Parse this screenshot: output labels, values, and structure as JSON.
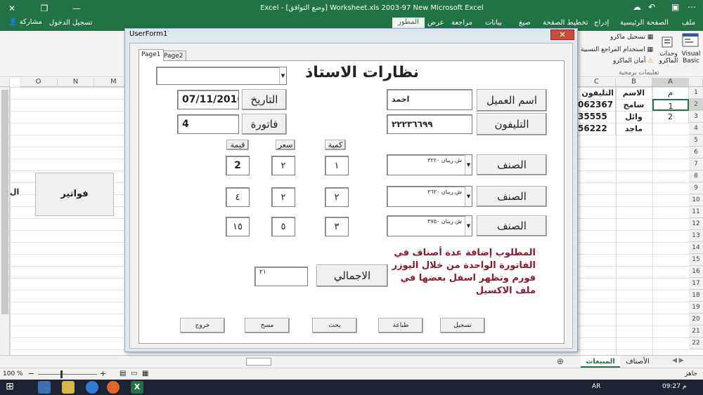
{
  "excel": {
    "title": "Excel - [وضع التوافق] Worksheet.xls 2003-97 New Microsoft Excel",
    "share": "مشاركة",
    "login": "تسجيل الدخول",
    "tabs": [
      "ملف",
      "الصفحة الرئيسية",
      "إدراج",
      "تخطيط الصفحة",
      "صيغ",
      "بيانات",
      "مراجعة",
      "عرض",
      "المطور"
    ],
    "active_tab": "المطور",
    "ribbon": {
      "visual_basic": "Visual Basic",
      "macros": "وحدات الماكرو",
      "record_macro": "تسجيل ماكرو",
      "relative_refs": "استخدام المراجع النسبية",
      "macro_security": "أمان الماكرو",
      "group_label": "تعليمات برمجية"
    },
    "columns": [
      "M",
      "N",
      "O",
      "C",
      "B",
      "A"
    ],
    "rows": [
      "1",
      "2",
      "3",
      "4",
      "5",
      "6",
      "7",
      "8",
      "9",
      "10",
      "11",
      "12",
      "13",
      "14",
      "15",
      "16",
      "17",
      "18",
      "19",
      "20",
      "21",
      "22"
    ],
    "cells": {
      "a1": "م",
      "a2": "1",
      "a3": "2",
      "b1": "الاسم",
      "b2": "سامح",
      "b3": "وائل",
      "b4": "ماجد",
      "c1": "التليفون",
      "c2": "062367",
      "c3": "35555",
      "c4": "56222",
      "left_fragment": "ال"
    },
    "sheet_button": "فواتير",
    "sheet_tabs": [
      "الأصناف",
      "المبيعات"
    ],
    "active_sheet": "المبيعات",
    "status": {
      "ready": "جاهز",
      "zoom": "100 %"
    },
    "taskbar": {
      "lang": "AR",
      "time": "09:27 م"
    }
  },
  "form": {
    "title": "UserForm1",
    "close": "✕",
    "pages": [
      "Page1",
      "Page2"
    ],
    "heading": "نظارات الاستاذ",
    "top_combo_value": "",
    "date_label": "التاريخ",
    "date_value": "07/11/2016",
    "invoice_label": "فاتورة",
    "invoice_value": "4",
    "client_label": "اسم العميل",
    "client_value": "احمد",
    "phone_label": "التليفون",
    "phone_value": "٢٢٢٣٦٦٩٩",
    "col_qty": "كمية",
    "col_price": "سعر",
    "col_value": "قيمة",
    "item_label": "الصنف",
    "items": [
      {
        "name": "ش.ريبان ٣٢٢٠",
        "qty": "١",
        "price": "٢",
        "value": "2"
      },
      {
        "name": "ش.ريبان ٣٦٢٠",
        "qty": "٢",
        "price": "٢",
        "value": "٤"
      },
      {
        "name": "ش.ريبان ٣٧٥٠",
        "qty": "٣",
        "price": "٥",
        "value": "١٥"
      }
    ],
    "total_label": "الاجمالي",
    "total_value": "٢١",
    "buttons": [
      "تسجيل",
      "طباعة",
      "بحث",
      "مسح",
      "خروج"
    ],
    "note": "المطلوب إضافة عدة أصناف في الفاتورة الواحدة من خلال اليوزر فورم وتظهر اسفل بعضها في ملف الاكسيل"
  },
  "colors": {
    "excel_green": "#217346",
    "note_red": "#8b1a2b"
  }
}
